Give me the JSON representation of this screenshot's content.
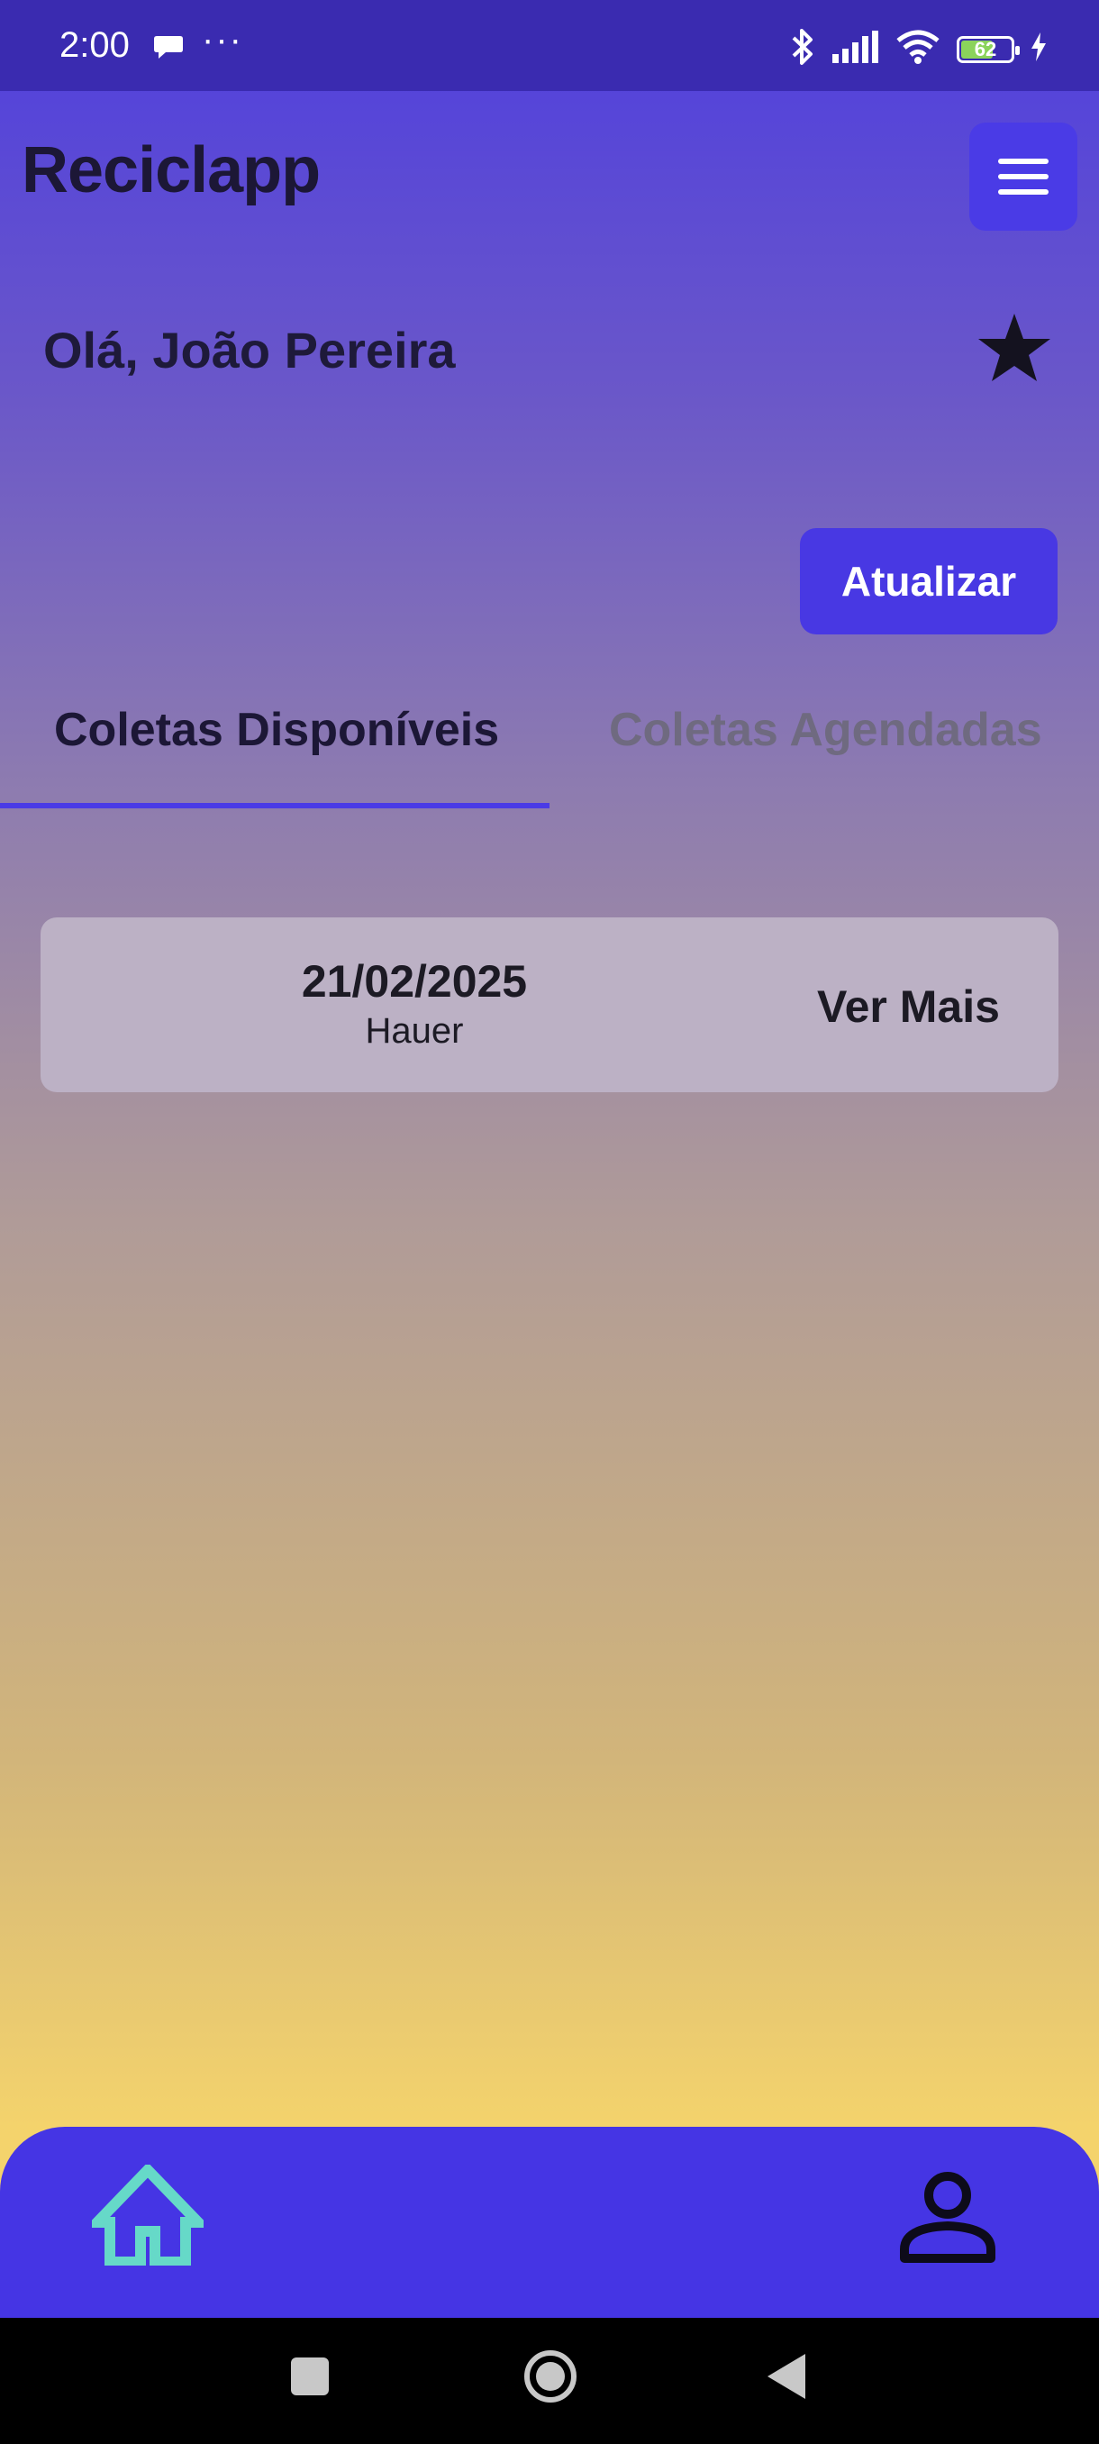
{
  "status_bar": {
    "time": "2:00",
    "dots": "···",
    "battery": "62"
  },
  "header": {
    "app_title": "Reciclapp",
    "menu_icon": "hamburger-menu-icon"
  },
  "greeting": {
    "text": "Olá, João Pereira",
    "star_icon": "star-icon"
  },
  "actions": {
    "refresh_label": "Atualizar"
  },
  "tabs": [
    {
      "label": "Coletas Disponíveis",
      "active": true
    },
    {
      "label": "Coletas Agendadas",
      "active": false
    }
  ],
  "collections": [
    {
      "date": "21/02/2025",
      "location": "Hauer",
      "action_label": "Ver Mais"
    }
  ],
  "bottom_nav": {
    "home_icon": "home-icon",
    "profile_icon": "profile-icon"
  },
  "colors": {
    "accent": "#4838e3",
    "home_icon": "#66d9c8",
    "status_bar": "#3a2bb0"
  }
}
